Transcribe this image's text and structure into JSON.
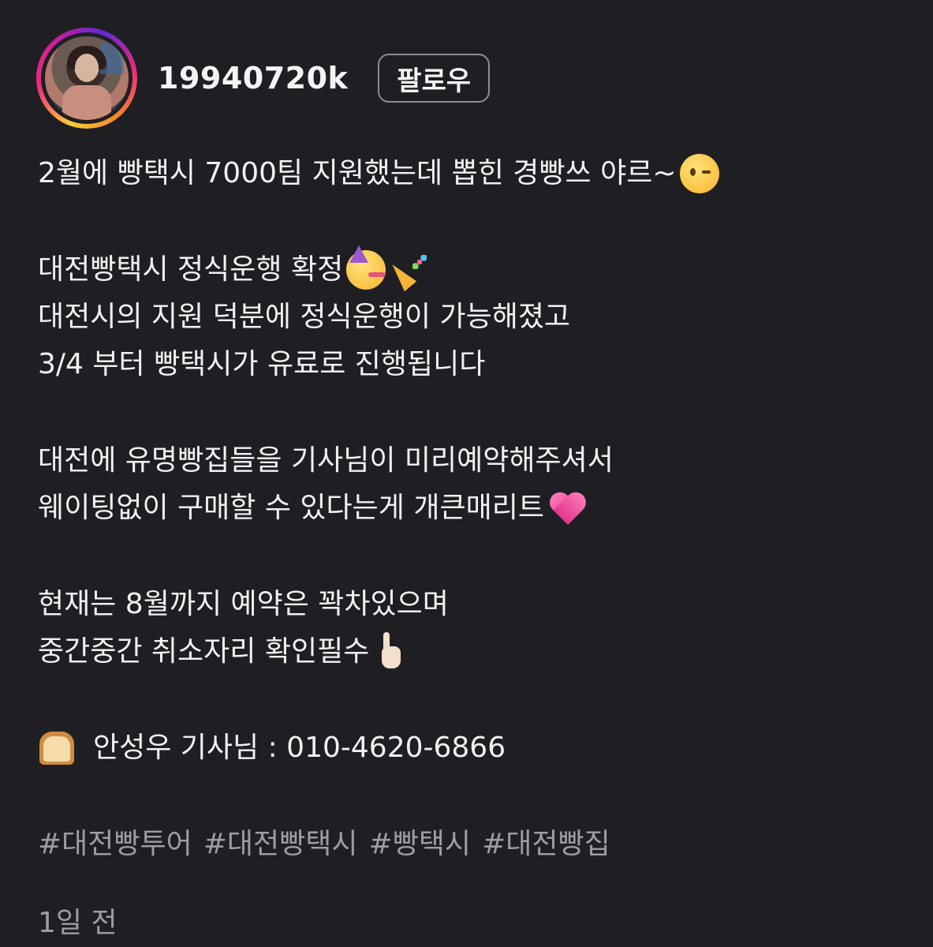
{
  "profile": {
    "username": "19940720k",
    "follow_label": "팔로우"
  },
  "post": {
    "lines": [
      "2월에 빵택시 7000팀 지원했는데 뽑힌 경빵쓰 야르~",
      "대전빵택시 정식운행 확정",
      "대전시의 지원 덕분에 정식운행이 가능해졌고",
      "3/4 부터 빵택시가 유료로 진행됩니다",
      "대전에 유명빵집들을 기사님이 미리예약해주셔서",
      "웨이팅없이 구매할 수 있다는게 개큰매리트",
      "현재는 8월까지 예약은 꽉차있으며",
      "중간중간 취소자리 확인필수",
      "안성우 기사님 : 010-4620-6866"
    ],
    "emojis": {
      "wink": "winking-face-emoji",
      "party_face": "partying-face-emoji",
      "popper": "party-popper-emoji",
      "heart": "growing-heart-emoji",
      "point": "index-pointing-up-emoji",
      "bread": "bread-emoji"
    },
    "hashtags": [
      "#대전빵투어",
      "#대전빵택시",
      "#빵택시",
      "#대전빵집"
    ],
    "timestamp": "1일 전"
  },
  "colors": {
    "background": "#1f1f23",
    "text": "#f1f1f3",
    "muted": "#9c9ca2",
    "button_border": "#8c8c94"
  }
}
